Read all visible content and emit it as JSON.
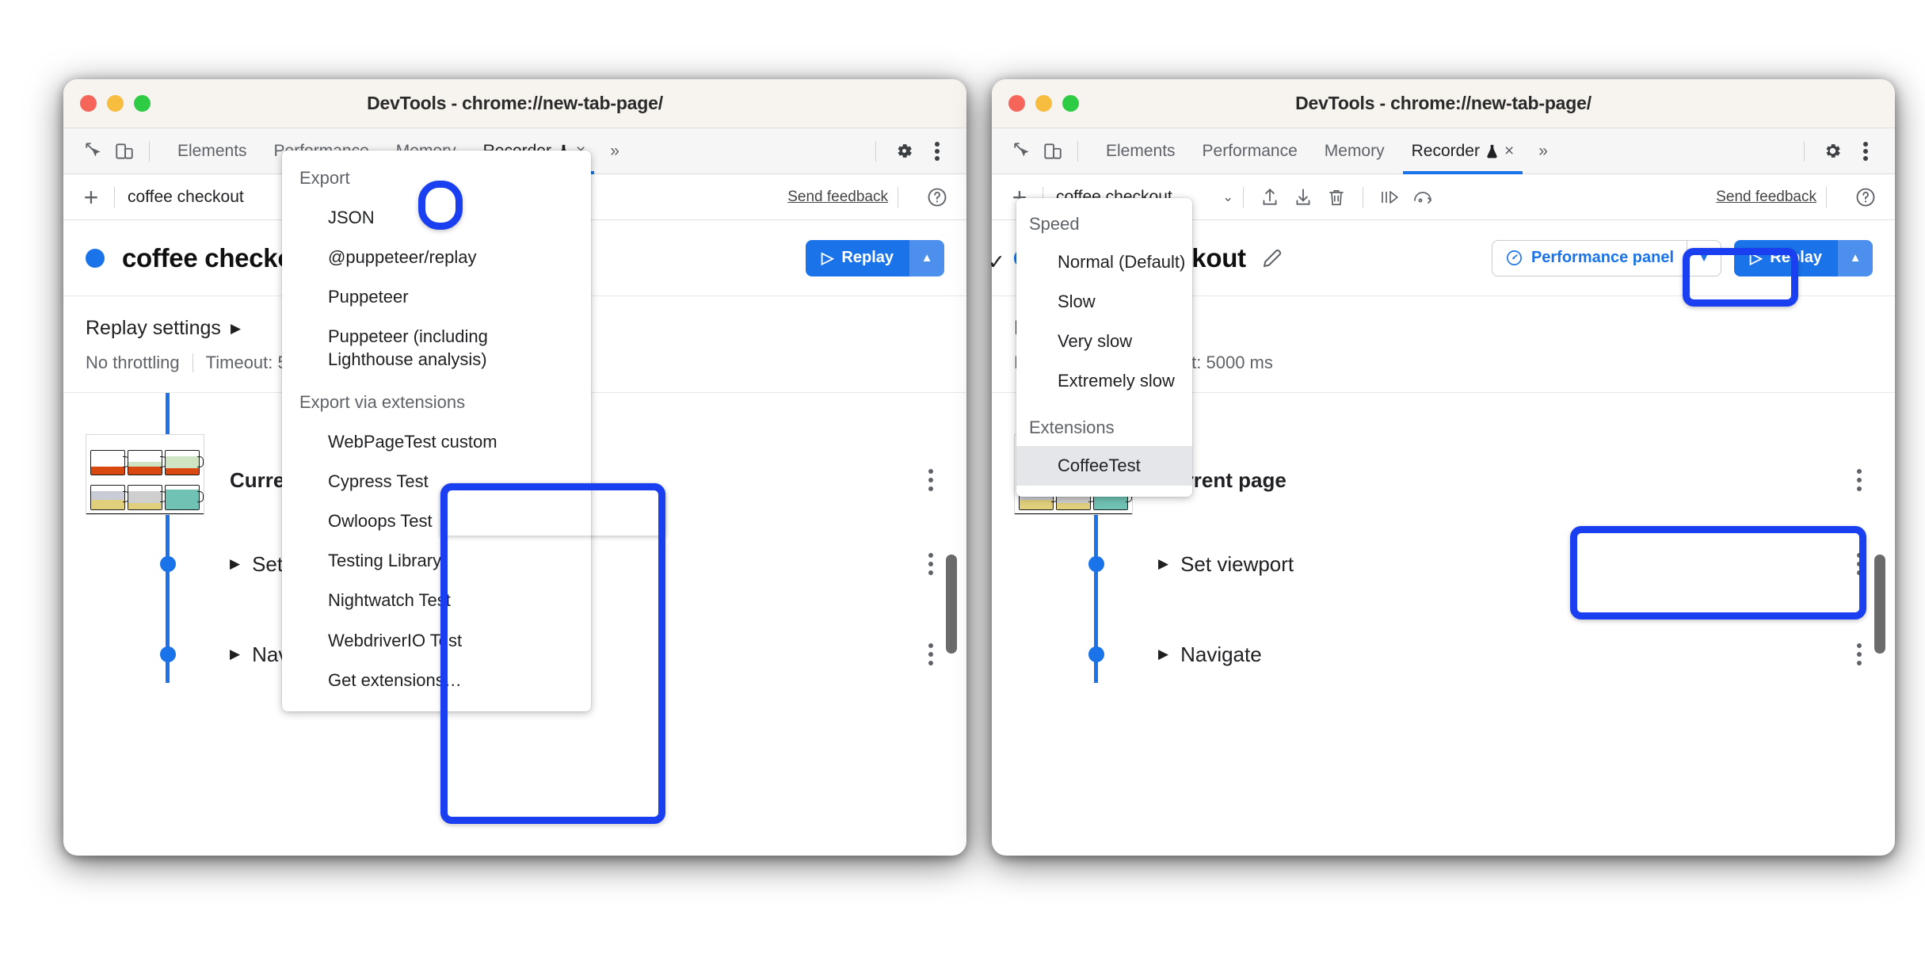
{
  "window_title": "DevTools - chrome://new-tab-page/",
  "traffic_lights": [
    "close",
    "minimize",
    "zoom"
  ],
  "devtools": {
    "icons": {
      "inspect": "inspect-element-icon",
      "device": "device-toolbar-icon",
      "settings": "gear-icon",
      "more": "more-vertical-icon",
      "overflow": "chevron-double-right-icon"
    },
    "tabs": [
      {
        "label": "Elements",
        "active": false
      },
      {
        "label": "Performance",
        "active": false
      },
      {
        "label": "Memory",
        "active": false
      },
      {
        "label": "Recorder",
        "active": true,
        "badge": "experiment-flask-icon",
        "close": "×"
      }
    ],
    "overflow_label": "»"
  },
  "recorder_toolbar": {
    "add_label": "+",
    "recording_name": "coffee checkout",
    "chevron": "⌄",
    "import_icon": "import-recording-icon",
    "export_icon": "export-recording-icon",
    "delete_icon": "trash-icon",
    "step_icon": "step-over-icon",
    "performance_icon": "measure-performance-icon",
    "feedback_label": "Send feedback",
    "help_icon": "help-circle-icon"
  },
  "recorder_header": {
    "status_dot": "blue-status-dot",
    "title": "coffee checkout",
    "edit_icon": "pencil-icon",
    "performance_panel_label": "Performance panel",
    "performance_panel_icon": "speedometer-icon",
    "performance_dropdown_arrow": "▼",
    "replay_label": "Replay",
    "replay_play_icon": "▷",
    "replay_dropdown_arrow": "▲"
  },
  "replay_settings": {
    "title": "Replay settings",
    "expand_arrow": "▶",
    "throttling": "No throttling",
    "timeout": "Timeout: 5000 ms"
  },
  "steps": [
    {
      "label": "Current page",
      "type": "current",
      "has_thumbnail": true,
      "has_kebab": true
    },
    {
      "label": "Set viewport",
      "type": "step",
      "expand_arrow": "▶",
      "has_kebab": true
    },
    {
      "label": "Navigate",
      "type": "step",
      "expand_arrow": "▶",
      "has_kebab": true
    }
  ],
  "export_menu": {
    "section_export": "Export",
    "export_items": [
      "JSON",
      "@puppeteer/replay",
      "Puppeteer",
      "Puppeteer (including Lighthouse analysis)"
    ],
    "section_extensions": "Export via extensions",
    "extension_items": [
      "WebPageTest custom",
      "Cypress Test",
      "Owloops Test",
      "Testing Library",
      "Nightwatch Test",
      "WebdriverIO Test",
      "Get extensions…"
    ]
  },
  "speed_menu": {
    "section_speed": "Speed",
    "speed_items": [
      {
        "label": "Normal (Default)",
        "checked": true
      },
      {
        "label": "Slow",
        "checked": false
      },
      {
        "label": "Very slow",
        "checked": false
      },
      {
        "label": "Extremely slow",
        "checked": false
      }
    ],
    "section_extensions": "Extensions",
    "extension_items": [
      {
        "label": "CoffeeTest",
        "highlighted": true
      }
    ]
  },
  "colors": {
    "annotation_ring": "#1a3ff0",
    "accent_blue": "#1a73e8",
    "replay_arrow_blue": "#4d8fec",
    "titlebar_bg": "#f7f3ee",
    "tabbar_bg": "#f6f6f6",
    "muted_text": "#5f6368"
  }
}
